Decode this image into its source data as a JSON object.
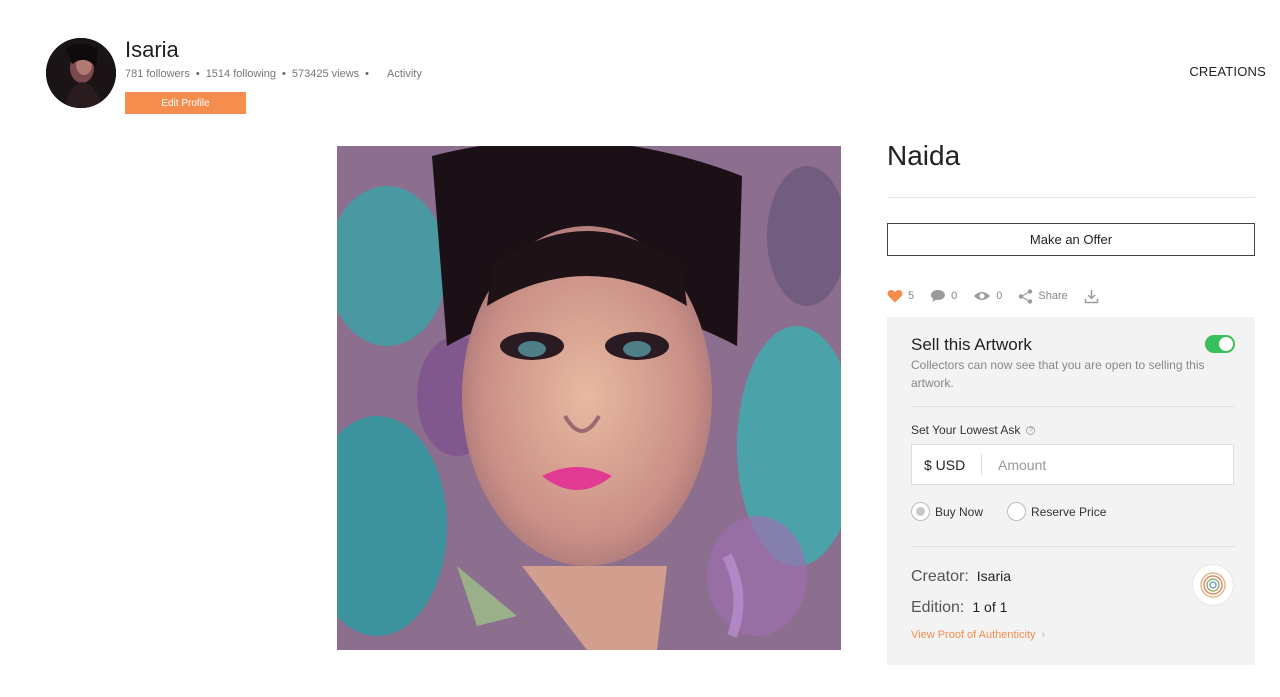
{
  "profile": {
    "username": "Isaria",
    "followers": "781 followers",
    "following": "1514 following",
    "views": "573425 views",
    "activity_link": "Activity",
    "edit_button": "Edit Profile"
  },
  "nav": {
    "creations": "CREATIONS"
  },
  "artwork": {
    "title": "Naida",
    "offer_button": "Make an Offer",
    "likes": "5",
    "comments": "0",
    "views": "0",
    "share_label": "Share",
    "icons": [
      "heart-icon",
      "comment-icon",
      "eye-icon",
      "share-icon",
      "download-icon"
    ]
  },
  "sell": {
    "title": "Sell this Artwork",
    "description": "Collectors can now see that you are open to selling this artwork.",
    "enabled": true,
    "lowest_ask_label": "Set Your Lowest Ask",
    "currency": "$ USD",
    "amount_placeholder": "Amount",
    "options": [
      "Buy Now",
      "Reserve Price"
    ],
    "selected_option": "Buy Now",
    "creator_label": "Creator:",
    "creator_value": "Isaria",
    "edition_label": "Edition:",
    "edition_value": "1 of 1",
    "proof_link": "View Proof of Authenticity"
  },
  "colors": {
    "accent": "#f58d4f",
    "toggle_on": "#37c05a",
    "panel_bg": "#f3f3f3"
  }
}
